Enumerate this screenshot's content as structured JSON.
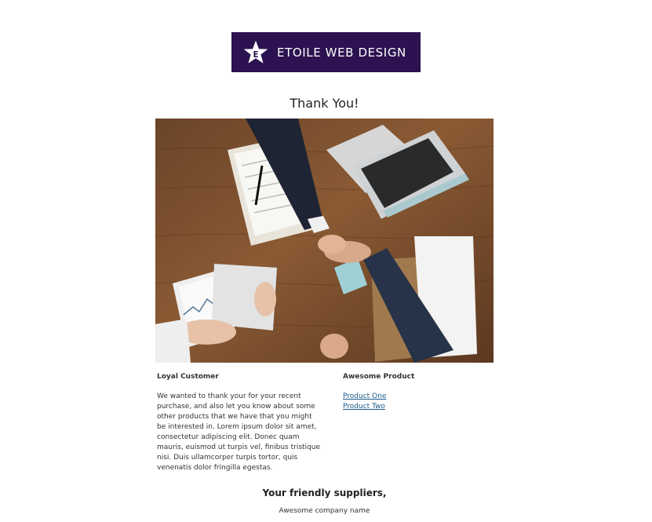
{
  "logo": {
    "star_letter": "E",
    "text": "ETOILE WEB DESIGN",
    "colors": {
      "background": "#2c1250",
      "foreground": "#ffffff"
    }
  },
  "title": "Thank You!",
  "hero_image": {
    "icon": "handshake-desk-photo"
  },
  "left_column": {
    "heading": "Loyal Customer",
    "body": "We wanted to thank your for your recent purchase, and also let you know about some other products that we have that you might be interested in. Lorem ipsum dolor sit amet, consectetur adipiscing elit. Donec quam mauris, euismod ut turpis vel, finibus tristique nisi. Duis ullamcorper turpis tortor, quis venenatis dolor fringilla egestas."
  },
  "right_column": {
    "heading": "Awesome Product",
    "links": [
      {
        "label": "Product One"
      },
      {
        "label": "Product Two"
      }
    ]
  },
  "signoff": "Your friendly suppliers,",
  "company_name": "Awesome company name",
  "colors": {
    "link": "#1a5a8a",
    "text": "#333333"
  }
}
